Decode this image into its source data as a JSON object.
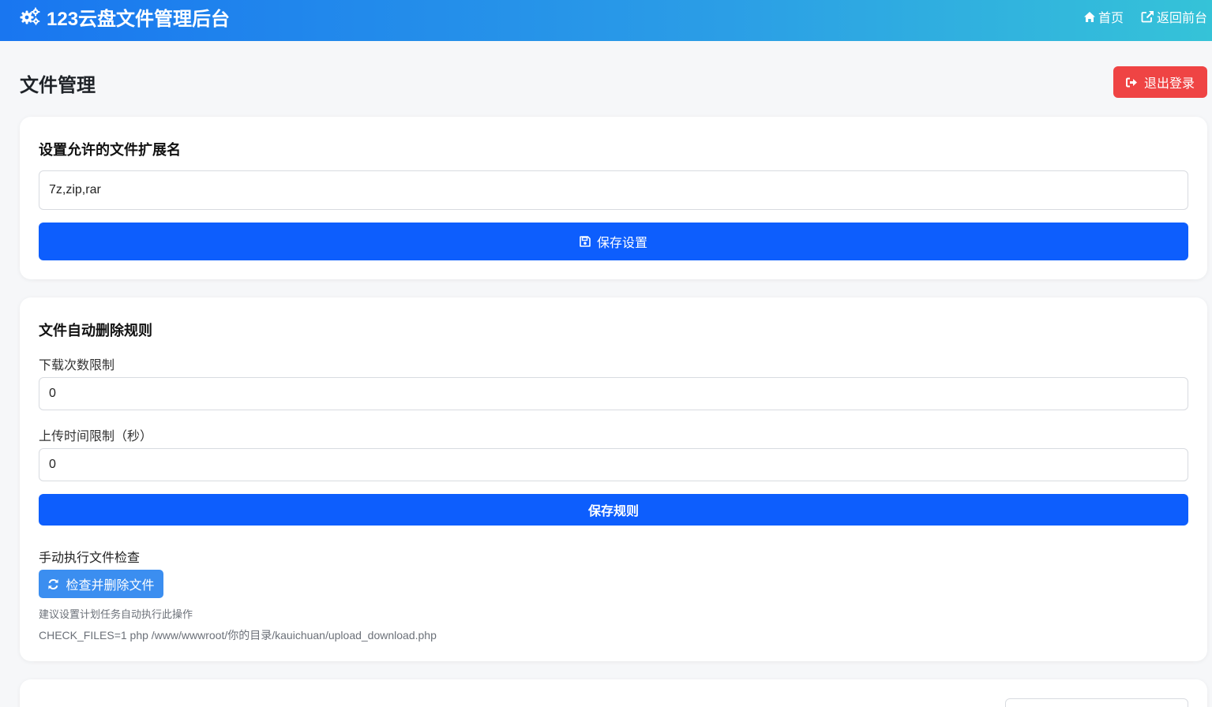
{
  "header": {
    "brand_title": "123云盘文件管理后台",
    "brand_icon": "cogs-icon",
    "nav": [
      {
        "label": "首页",
        "icon": "home-icon"
      },
      {
        "label": "返回前台",
        "icon": "external-link-icon"
      }
    ]
  },
  "page": {
    "title": "文件管理",
    "logout_label": "退出登录",
    "logout_icon": "sign-out-icon"
  },
  "extensions_card": {
    "title": "设置允许的文件扩展名",
    "input_value": "7z,zip,rar",
    "save_label": "保存设置",
    "save_icon": "save-icon"
  },
  "rules_card": {
    "title": "文件自动删除规则",
    "download_limit_label": "下载次数限制",
    "download_limit_value": "0",
    "upload_time_label": "上传时间限制（秒）",
    "upload_time_value": "0",
    "save_rules_label": "保存规则",
    "manual_check_label": "手动执行文件检查",
    "check_button_label": "检查并删除文件",
    "check_button_icon": "refresh-icon",
    "hint_text": "建议设置计划任务自动执行此操作",
    "cron_command": "CHECK_FILES=1 php /www/wwwroot/你的目录/kauichuan/upload_download.php"
  },
  "colors": {
    "primary": "#0d5efd",
    "danger": "#ef4444",
    "secondary_button": "#3b8ef0",
    "header_gradient_start": "#1976f0",
    "header_gradient_end": "#35c3d8"
  }
}
